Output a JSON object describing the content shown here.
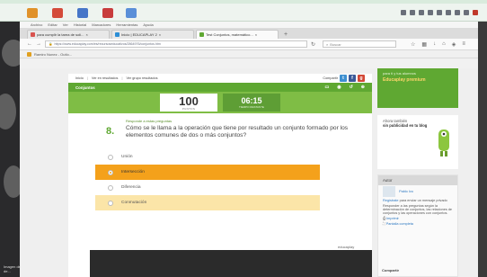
{
  "browser": {
    "menu": [
      "Archivo",
      "Editar",
      "Ver",
      "Historial",
      "Marcadores",
      "Herramientas",
      "Ayuda"
    ],
    "tabs": [
      {
        "label": "para cumplir la tarea de soli...",
        "fav_color": "#d9534f"
      },
      {
        "label": "Inicio | EDUCAPLAY 2",
        "fav_color": "#2c8ed6"
      },
      {
        "label": "Test Conjuntos, matemático...",
        "fav_color": "#5fa832"
      }
    ],
    "url": "https://www.educaplay.com/es/recursoseducativos/2864976/conjuntos.htm",
    "search_placeholder": "Buscar",
    "bookmark": "Ramiro Nunez - Outlo..."
  },
  "breadcrumbs": {
    "items": [
      "Inicio",
      "Ver en resultados",
      "Ver grupo resultados"
    ],
    "share_label": "Compartir"
  },
  "quiz": {
    "title": "Conjuntos",
    "score": "100",
    "score_label": "PUNTOS",
    "time": "06:15",
    "time_label": "TIEMPO RESTANTE",
    "hint": "Responde a estas preguntas",
    "number": "8.",
    "question": "Cómo se le llama a la operación que tiene por resultado un conjunto formado por los elementos comunes de dos o más conjuntos?",
    "options": [
      "Unión",
      "Intersección",
      "Diferencia",
      "Conmutación"
    ],
    "selected_index": 1
  },
  "footer": {
    "brand": "educaplay"
  },
  "sidebar": {
    "promo_text": "para ti y tus alumnos",
    "promo_highlight": "Educaplay premium",
    "blog_text": "Ahora también",
    "blog_strong": "sin publicidad en tu blog",
    "author_head": "Autor",
    "author_name": "Pablo Ivo",
    "author_register": "Regístrate",
    "author_register_suffix": "para enviar un mensaje privado",
    "author_desc": "Responder a las preguntas según la determinación de conjuntos, las relaciones de conjuntos y las operaciones con conjuntos.",
    "print": "Imprimir",
    "fullscreen": "Pantalla completa",
    "share": "Compartir"
  },
  "desktop": {
    "caption": "Imagen de archivo de..."
  },
  "colors": {
    "green": "#5fa832",
    "green_light": "#7fbd45",
    "orange_selected": "#f4a11b",
    "yellow_hover": "#fbe5a8"
  }
}
